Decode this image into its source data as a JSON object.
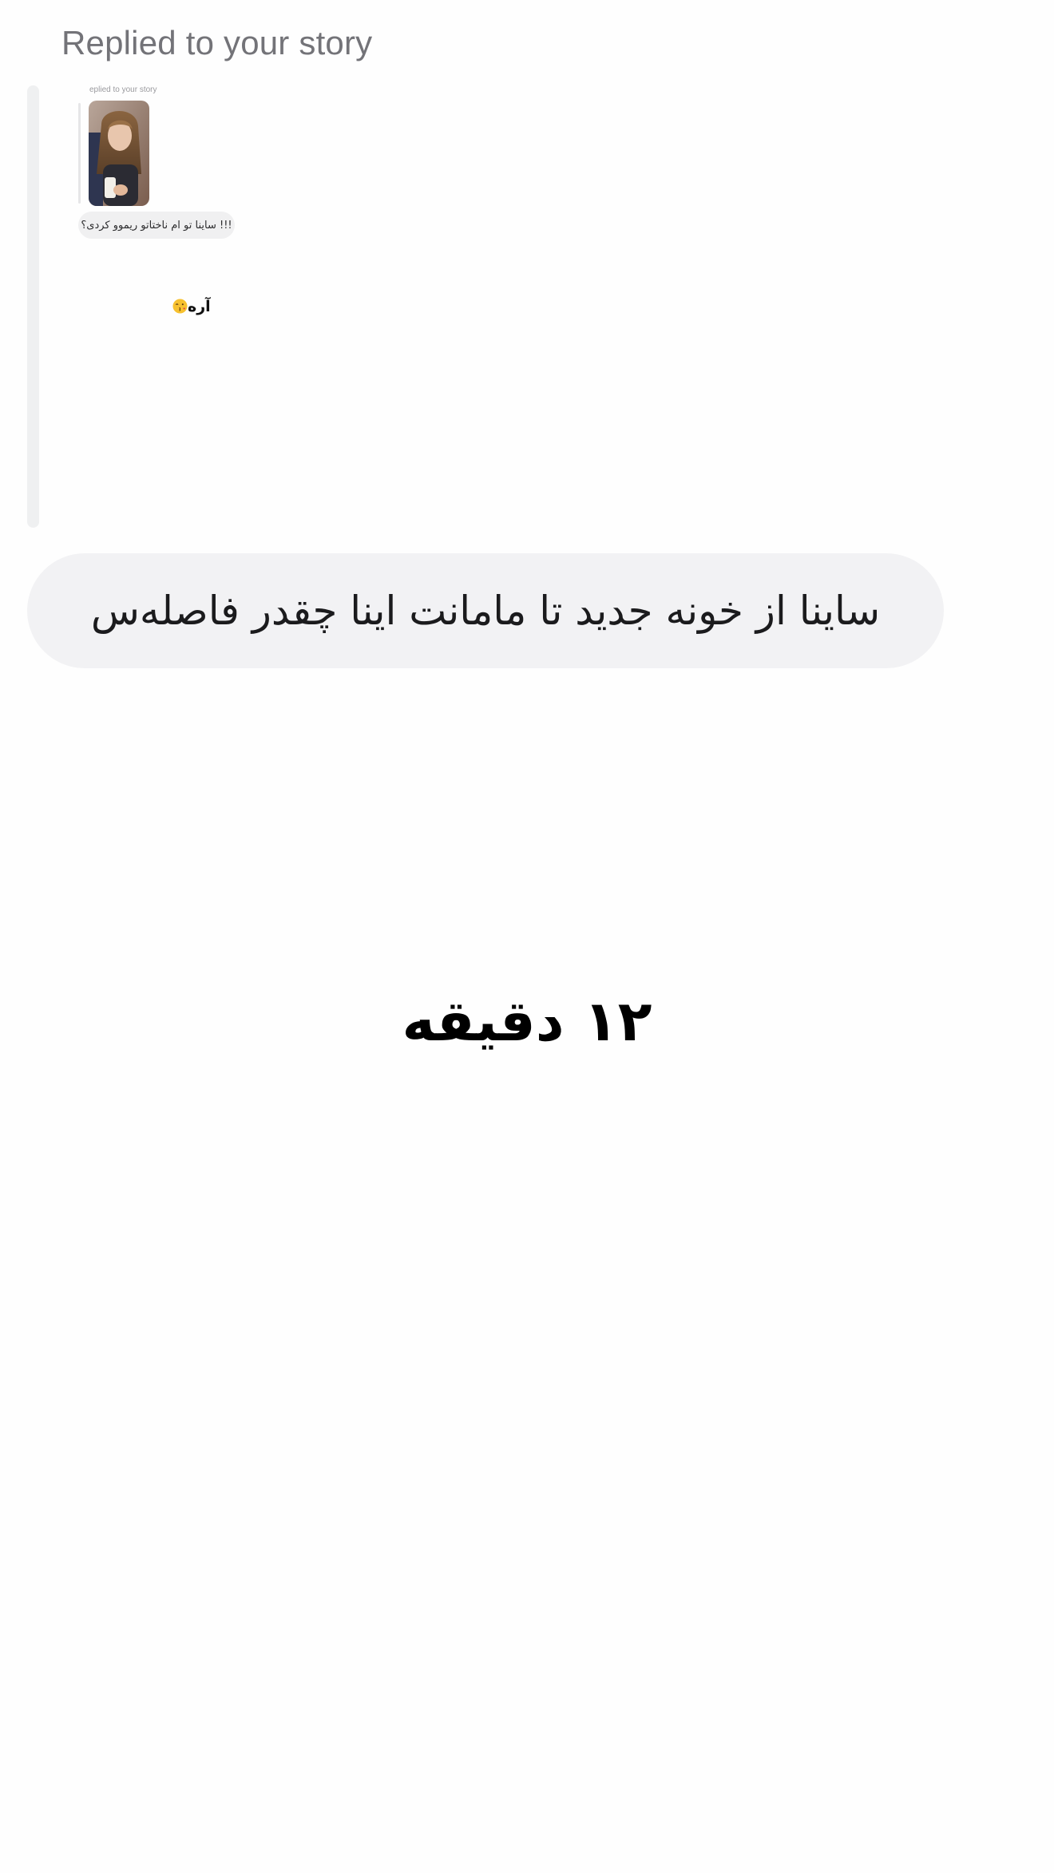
{
  "reply_context": {
    "label": "Replied to your story"
  },
  "quoted_screenshot": {
    "header": "eplied to your story",
    "story_message": "!!! ساینا تو ام ناختاتو ریموو کردی؟",
    "reply": "آره",
    "reply_emoji": "kissing-face-icon"
  },
  "message": {
    "text": "ساینا از خونه جدید تا مامانت اینا چقدر فاصله‌س"
  },
  "answer": {
    "text": "۱۲ دقیقه"
  },
  "colors": {
    "background": "#fefefe",
    "bubble": "#f2f2f4",
    "header_text": "#737378",
    "quote_bar": "#eff0f1"
  }
}
